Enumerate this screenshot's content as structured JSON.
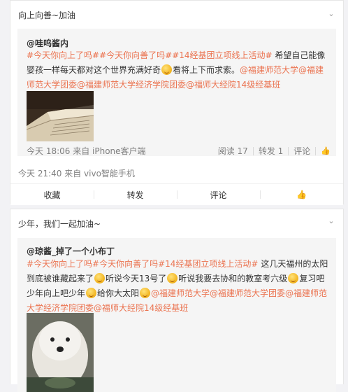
{
  "post1": {
    "text": "向上向善~加油",
    "repost": {
      "author": "@哇呜酱内",
      "topic1": "#今天你向上了吗##今天你向善了吗##14经基团立项线上活动#",
      "body_a": " 希望自己能像婴孩一样每天都对这个世界充满好奇",
      "body_b": "看将上下而求索。",
      "mention": "@福建师范大学@福建师范大学团委@福建师范大学经济学院团委@福师大经院14级经基班",
      "time_source": "今天 18:06 来自 iPhone客户端",
      "stats": {
        "read": "阅读 17",
        "repost": "转发 1",
        "comment": "评论"
      }
    },
    "time_source": "今天 21:40 来自 vivo智能手机",
    "actions": {
      "fav": "收藏",
      "repost": "转发",
      "comment": "评论"
    }
  },
  "post2": {
    "text": "少年，我们一起加油~",
    "repost": {
      "author": "@琼酱_掉了一个小布丁",
      "topic1": "#今天你向上了吗#今天你向善了吗#14经基团立项线上活动#",
      "s1": " 这几天福州的太阳到底被谁藏起来了",
      "s2": "听说今天13号了",
      "s3": "听说我要去协和的教室考六级",
      "s4": "复习吧少年向上吧少年",
      "s5": "给你大太阳",
      "mention": "@福建师范大学@福建师范大学团委@福建师范大学经济学院团委@福师大经院14级经基班"
    }
  },
  "icons": [
    "chevron-down-icon",
    "like-icon",
    "emoji-icon"
  ],
  "colors": {
    "link": "#eb7350",
    "meta": "#808080",
    "repost_bg": "#f5f5f5"
  }
}
